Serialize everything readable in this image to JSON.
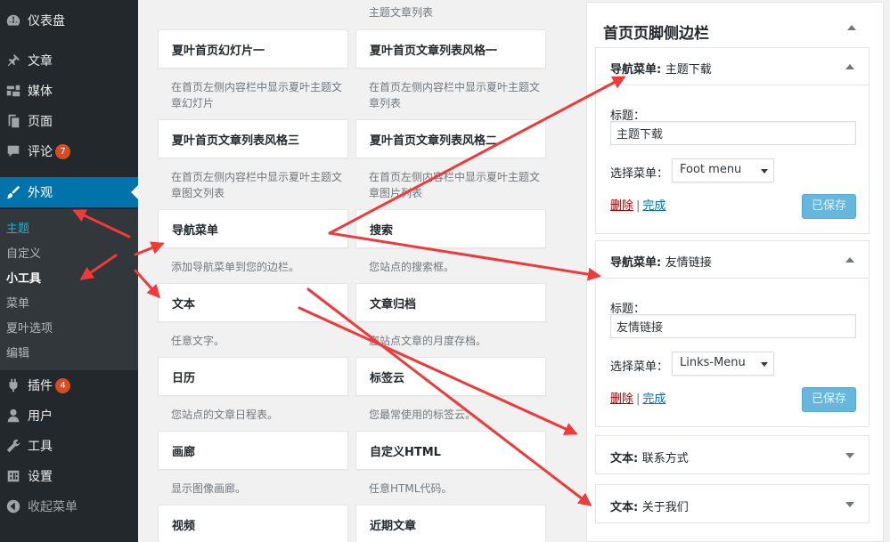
{
  "sidebar": {
    "items": [
      {
        "label": "仪表盘",
        "icon": "dashboard-icon"
      },
      {
        "label": "文章",
        "icon": "pin-icon"
      },
      {
        "label": "媒体",
        "icon": "media-icon"
      },
      {
        "label": "页面",
        "icon": "page-icon"
      },
      {
        "label": "评论",
        "icon": "comment-icon",
        "badge": "7"
      },
      {
        "label": "外观",
        "icon": "brush-icon"
      },
      {
        "label": "插件",
        "icon": "plugin-icon",
        "badge": "4"
      },
      {
        "label": "用户",
        "icon": "user-icon"
      },
      {
        "label": "工具",
        "icon": "wrench-icon"
      },
      {
        "label": "设置",
        "icon": "settings-icon"
      },
      {
        "label": "收起菜单",
        "icon": "collapse-icon"
      }
    ],
    "submenu": [
      "主题",
      "自定义",
      "小工具",
      "菜单",
      "夏叶选项",
      "编辑"
    ]
  },
  "widgets": {
    "top_desc_right": "主题文章列表",
    "items": [
      {
        "title": "夏叶首页幻灯片一",
        "desc": "在首页左侧内容栏中显示夏叶主题文章幻灯片"
      },
      {
        "title": "夏叶首页文章列表风格一",
        "desc": "在首页左侧内容栏中显示夏叶主题文章列表"
      },
      {
        "title": "夏叶首页文章列表风格三",
        "desc": "在首页左侧内容栏中显示夏叶主题文章图文列表"
      },
      {
        "title": "夏叶首页文章列表风格二",
        "desc": "在首页左侧内容栏中显示夏叶主题文章图片列表"
      },
      {
        "title": "导航菜单",
        "desc": "添加导航菜单到您的边栏。"
      },
      {
        "title": "搜索",
        "desc": "您站点的搜索框。"
      },
      {
        "title": "文本",
        "desc": "任意文字。"
      },
      {
        "title": "文章归档",
        "desc": "您站点文章的月度存档。"
      },
      {
        "title": "日历",
        "desc": "您站点的文章日程表。"
      },
      {
        "title": "标签云",
        "desc": "您最常使用的标签云。"
      },
      {
        "title": "画廊",
        "desc": "显示图像画廊。"
      },
      {
        "title": "自定义HTML",
        "desc": "任意HTML代码。"
      },
      {
        "title": "视频",
        "desc": ""
      },
      {
        "title": "近期文章",
        "desc": ""
      }
    ]
  },
  "area": {
    "title": "首页页脚侧边栏",
    "widgets": [
      {
        "type": "导航菜单:",
        "name": "主题下载",
        "title_label": "标题：",
        "title_value": "主题下载",
        "select_label": "选择菜单：",
        "select_value": "Foot menu",
        "delete": "删除",
        "sep": "|",
        "done": "完成",
        "save": "已保存"
      },
      {
        "type": "导航菜单:",
        "name": "友情链接",
        "title_label": "标题：",
        "title_value": "友情链接",
        "select_label": "选择菜单：",
        "select_value": "Links-Menu",
        "delete": "删除",
        "sep": "|",
        "done": "完成",
        "save": "已保存"
      },
      {
        "type": "文本:",
        "name": "联系方式"
      },
      {
        "type": "文本:",
        "name": "关于我们"
      }
    ]
  },
  "colors": {
    "accent": "#0073aa",
    "annotation_arrow": "#ee3a3a"
  }
}
